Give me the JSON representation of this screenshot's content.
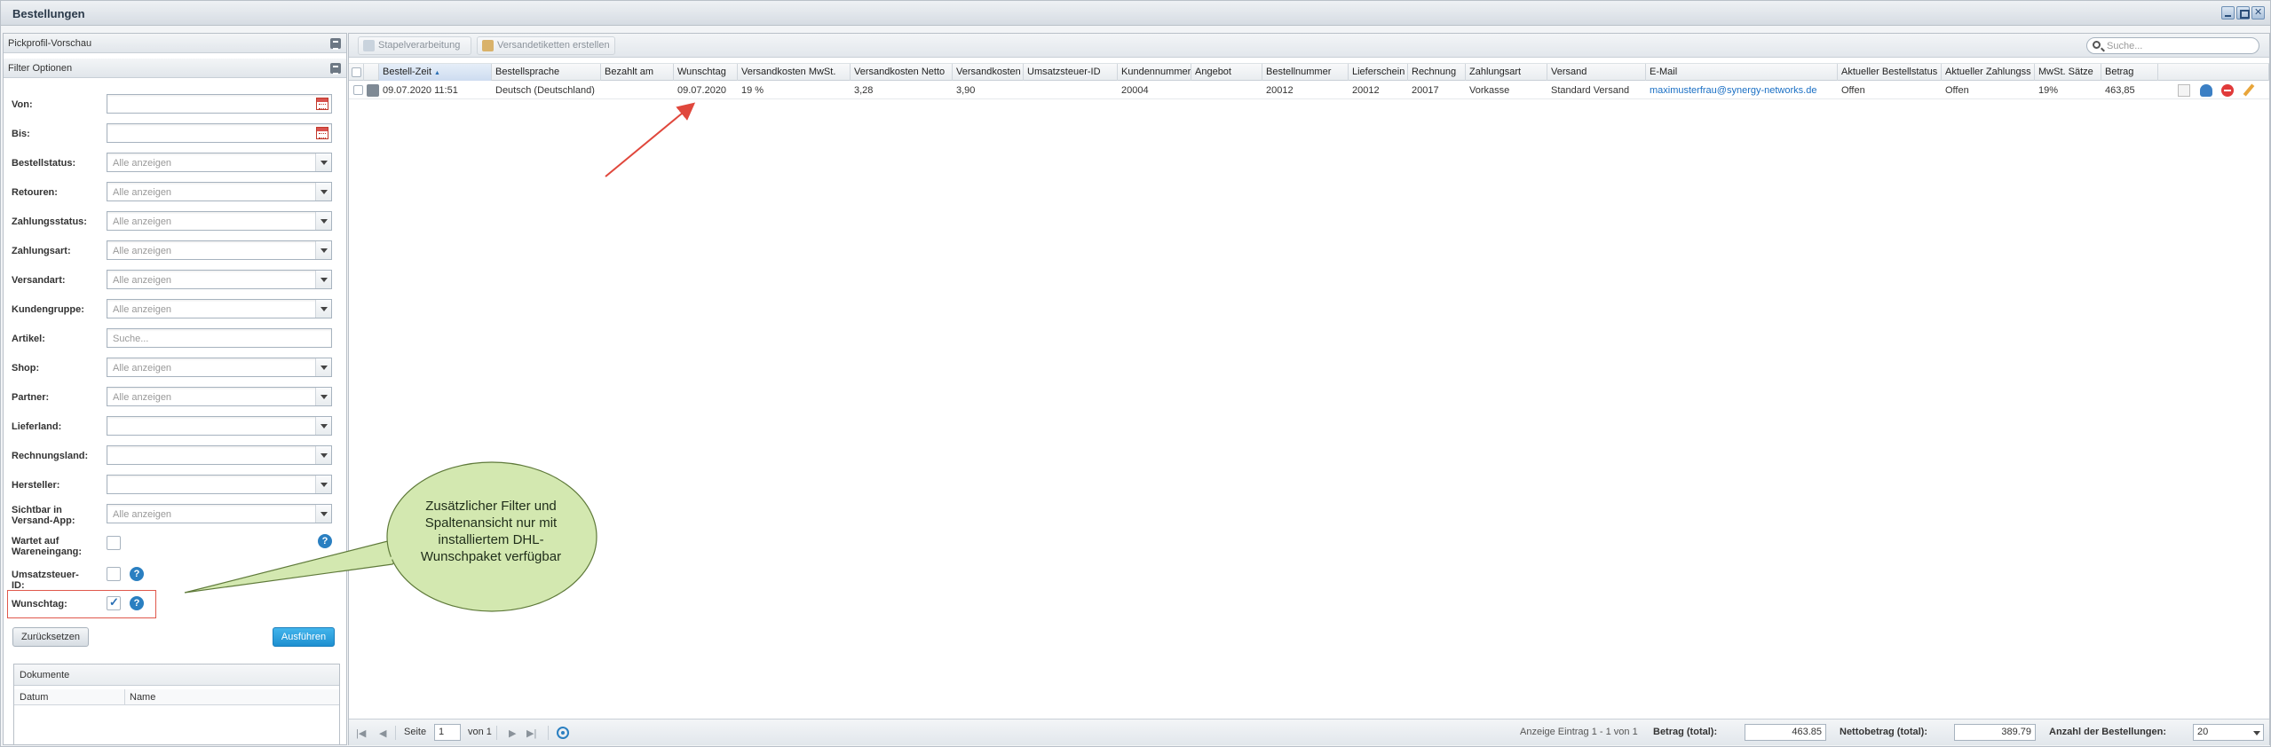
{
  "window": {
    "title": "Bestellungen"
  },
  "left": {
    "pick_profile": "Pickprofil-Vorschau",
    "filter_section": "Filter Optionen",
    "filters": [
      {
        "label": "Von:",
        "type": "date",
        "placeholder": ""
      },
      {
        "label": "Bis:",
        "type": "date",
        "placeholder": ""
      },
      {
        "label": "Bestellstatus:",
        "type": "select",
        "placeholder": "Alle anzeigen"
      },
      {
        "label": "Retouren:",
        "type": "select",
        "placeholder": "Alle anzeigen"
      },
      {
        "label": "Zahlungsstatus:",
        "type": "select",
        "placeholder": "Alle anzeigen"
      },
      {
        "label": "Zahlungsart:",
        "type": "select",
        "placeholder": "Alle anzeigen"
      },
      {
        "label": "Versandart:",
        "type": "select",
        "placeholder": "Alle anzeigen"
      },
      {
        "label": "Kundengruppe:",
        "type": "select",
        "placeholder": "Alle anzeigen"
      },
      {
        "label": "Artikel:",
        "type": "text",
        "placeholder": "Suche..."
      },
      {
        "label": "Shop:",
        "type": "select",
        "placeholder": "Alle anzeigen"
      },
      {
        "label": "Partner:",
        "type": "select",
        "placeholder": "Alle anzeigen"
      },
      {
        "label": "Lieferland:",
        "type": "select",
        "placeholder": ""
      },
      {
        "label": "Rechnungsland:",
        "type": "select",
        "placeholder": ""
      },
      {
        "label": "Hersteller:",
        "type": "select",
        "placeholder": ""
      },
      {
        "label": "Sichtbar in Versand-App:",
        "type": "select",
        "placeholder": "Alle anzeigen"
      }
    ],
    "checkboxes": {
      "wareneingang": {
        "label": "Wartet auf Wareneingang:",
        "checked": false
      },
      "ustid": {
        "label": "Umsatzsteuer-ID:",
        "checked": false
      },
      "wunschtag": {
        "label": "Wunschtag:",
        "checked": true
      }
    },
    "help_glyph": "?",
    "reset_label": "Zurücksetzen",
    "run_label": "Ausführen",
    "documents": {
      "title": "Dokumente",
      "col_date": "Datum",
      "col_name": "Name"
    }
  },
  "toolbar": {
    "batch_label": "Stapelverarbeitung",
    "labels_label": "Versandetiketten erstellen",
    "search_placeholder": "Suche..."
  },
  "grid": {
    "columns": [
      "Bestell-Zeit",
      "Bestellsprache",
      "Bezahlt am",
      "Wunschtag",
      "Versandkosten MwSt.",
      "Versandkosten Netto",
      "Versandkosten",
      "Umsatzsteuer-ID",
      "Kundennummer",
      "Angebot",
      "Bestellnummer",
      "Lieferschein",
      "Rechnung",
      "Zahlungsart",
      "Versand",
      "E-Mail",
      "Aktueller Bestellstatus",
      "Aktueller Zahlungss",
      "MwSt. Sätze",
      "Betrag"
    ],
    "sort_arrow": "▲",
    "rows": [
      [
        "09.07.2020 11:51",
        "Deutsch (Deutschland)",
        "",
        "09.07.2020",
        "19 %",
        "3,28",
        "3,90",
        "",
        "20004",
        "",
        "20012",
        "20012",
        "20017",
        "Vorkasse",
        "Standard Versand",
        "maximusterfrau@synergy-networks.de",
        "Offen",
        "Offen",
        "19%",
        "463,85"
      ]
    ]
  },
  "pager": {
    "first": "|◀",
    "prev": "◀",
    "page_label": "Seite",
    "page_value": "1",
    "of_label": "von 1",
    "next": "▶",
    "last": "▶|",
    "display": "Anzeige Eintrag 1 - 1 von 1",
    "total_label": "Betrag (total):",
    "total_value": "463.85",
    "net_label": "Nettobetrag (total):",
    "net_value": "389.79",
    "count_label": "Anzahl der Bestellungen:",
    "count_value": "20"
  },
  "callout": {
    "text": "Zusätzlicher Filter und Spaltenansicht nur mit installiertem DHL-Wunschpaket verfügbar"
  },
  "colors": {
    "callout_fill": "#d3e8b0",
    "callout_stroke": "#5f7a3a",
    "annotation_red": "#e0473c",
    "accent": "#1d8fd0"
  }
}
